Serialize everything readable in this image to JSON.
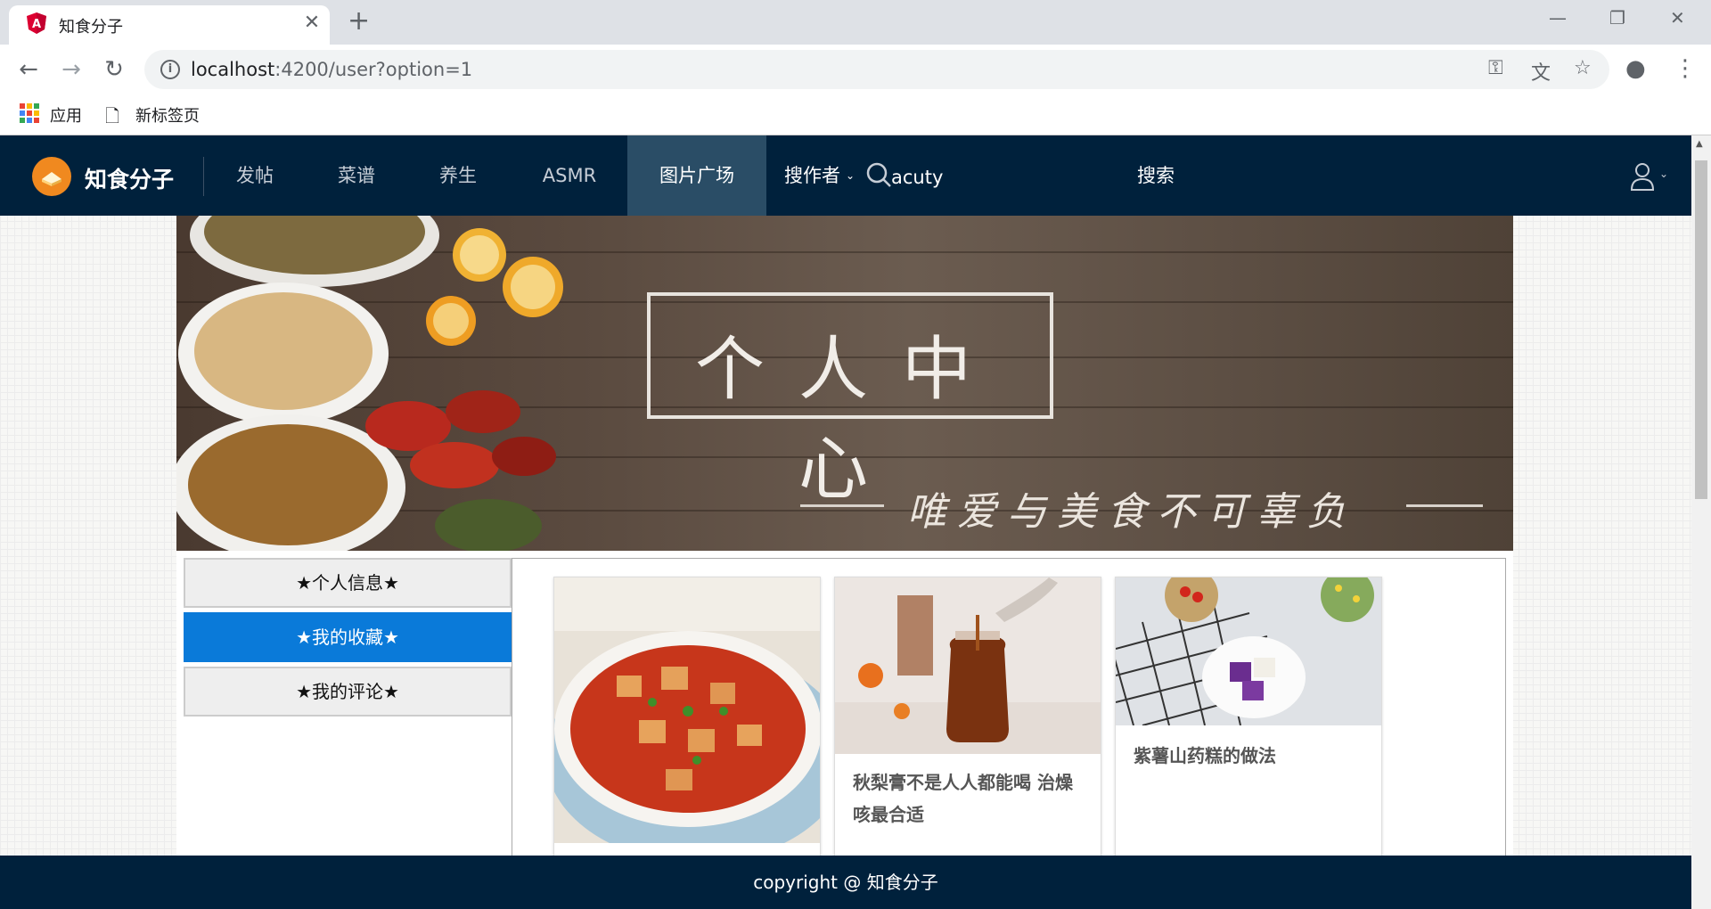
{
  "browser": {
    "tab_title": "知食分子",
    "url_host": "localhost",
    "url_path": ":4200/user?option=1",
    "bookmarks": [
      "应用",
      "新标签页"
    ]
  },
  "navbar": {
    "brand": "知食分子",
    "items": [
      "发帖",
      "菜谱",
      "养生",
      "ASMR",
      "图片广场"
    ],
    "active_item": "图片广场",
    "search_type": "搜作者",
    "search_value": "acuty",
    "search_button": "搜索"
  },
  "banner": {
    "title": "个人中心",
    "subtitle": "唯爱与美食不可辜负"
  },
  "side_menu": {
    "items": [
      "★个人信息★",
      "★我的收藏★",
      "★我的评论★"
    ],
    "active": "★我的收藏★"
  },
  "cards": [
    {
      "title": ""
    },
    {
      "title": "秋梨膏不是人人都能喝 治燥咳最合适"
    },
    {
      "title": "紫薯山药糕的做法"
    }
  ],
  "footer": {
    "text": "copyright @ 知食分子"
  },
  "colors": {
    "navbar_bg": "#00213c",
    "active_nav": "#2a4d66",
    "active_menu": "#0a7ad9",
    "logo": "#f0891f"
  }
}
